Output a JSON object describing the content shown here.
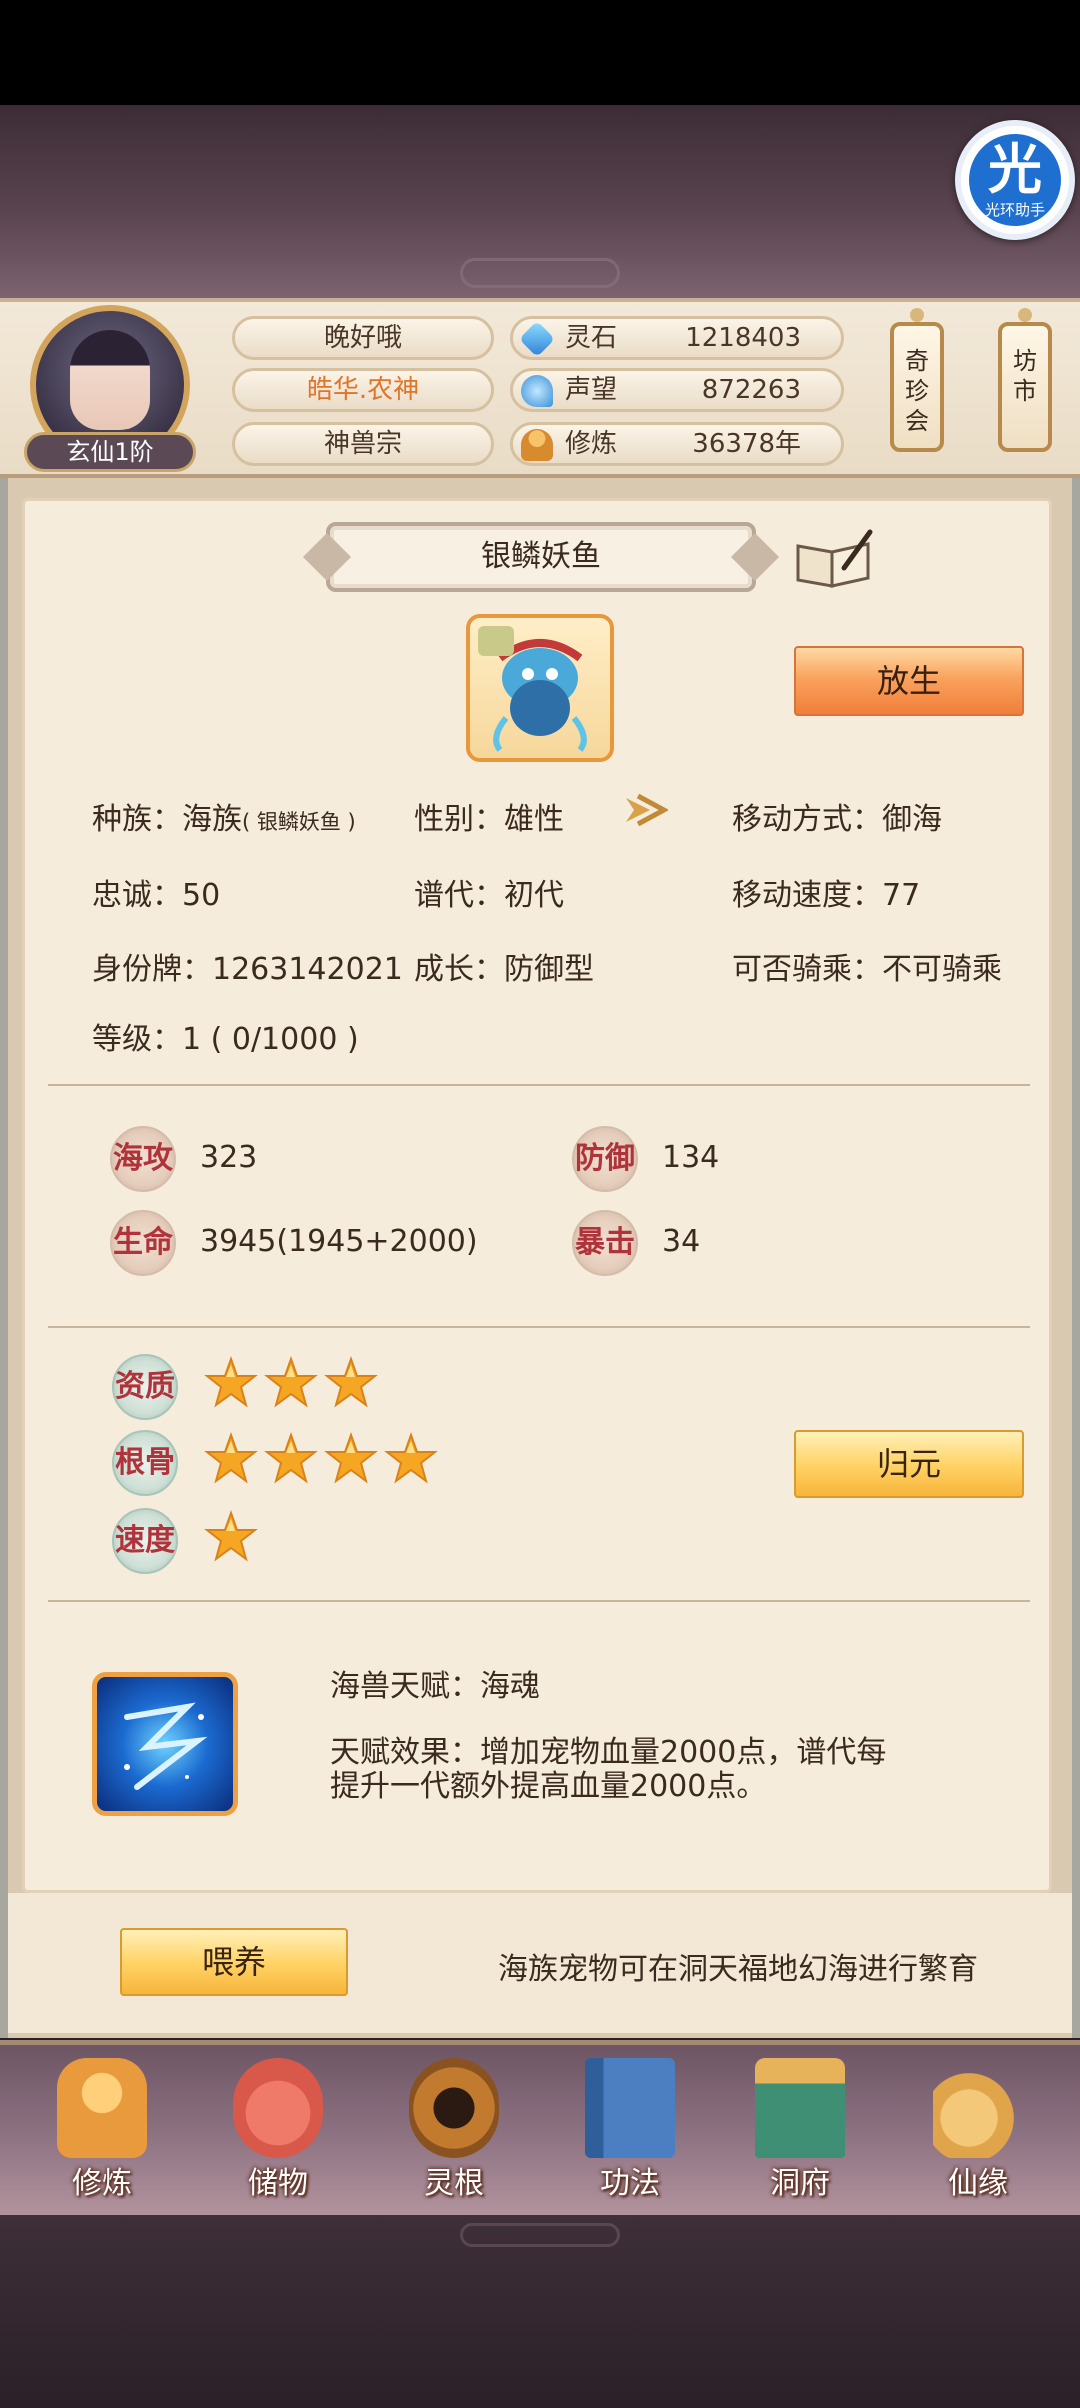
{
  "header": {
    "rank": "玄仙1阶",
    "greeting": "晚好哦",
    "player_name": "皓华.农神",
    "sect": "神兽宗",
    "stats": [
      {
        "label": "灵石",
        "value": "1218403",
        "icon": "spirit-stone-icon"
      },
      {
        "label": "声望",
        "value": "872263",
        "icon": "prestige-icon"
      },
      {
        "label": "修炼",
        "value": "36378年",
        "icon": "cultivation-icon"
      }
    ],
    "side_tags": [
      "奇珍会",
      "坊市"
    ]
  },
  "assistant": {
    "glyph": "光",
    "label": "光环助手"
  },
  "pet": {
    "title": "银鳞妖鱼",
    "release_button": "放生",
    "info": {
      "race_label": "种族：",
      "race_value": "海族",
      "race_note": "( 银鳞妖鱼 )",
      "gender": "性别：雄性",
      "move_mode": "移动方式：御海",
      "loyalty": "忠诚：50",
      "generation": "谱代：初代",
      "move_speed": "移动速度：77",
      "id_card": "身份牌：1263142021",
      "growth": "成长：防御型",
      "rideable": "可否骑乘：不可骑乘",
      "level": "等级：1 ( 0/1000 )"
    },
    "combat": [
      {
        "label": "海攻",
        "value": "323"
      },
      {
        "label": "防御",
        "value": "134"
      },
      {
        "label": "生命",
        "value": "3945(1945+2000)"
      },
      {
        "label": "暴击",
        "value": "34"
      }
    ],
    "aptitude": [
      {
        "label": "资质",
        "stars": 3
      },
      {
        "label": "根骨",
        "stars": 4
      },
      {
        "label": "速度",
        "stars": 1
      }
    ],
    "return_button": "归元",
    "talent": {
      "name": "海兽天赋：海魂",
      "effect_line1": "天赋效果：增加宠物血量2000点，谱代每",
      "effect_line2": "提升一代额外提高血量2000点。"
    }
  },
  "feed": {
    "button": "喂养",
    "hint": "海族宠物可在洞天福地幻海进行繁育"
  },
  "nav": [
    {
      "label": "修炼",
      "icon": "cultivate-icon",
      "color": "#e89a3c"
    },
    {
      "label": "储物",
      "icon": "storage-bag-icon",
      "color": "#d8584a"
    },
    {
      "label": "灵根",
      "icon": "spirit-root-icon",
      "color": "#c27b2e"
    },
    {
      "label": "功法",
      "icon": "technique-book-icon",
      "color": "#4b7fc2"
    },
    {
      "label": "洞府",
      "icon": "cave-abode-icon",
      "color": "#3f8f74"
    },
    {
      "label": "仙缘",
      "icon": "immortal-fate-icon",
      "color": "#e0a44a"
    }
  ],
  "colors": {
    "panel_bg": "#f6ecdb",
    "accent_orange": "#f07f3a",
    "accent_yellow": "#ffd468",
    "stat_red": "#b0333b",
    "star_gold": "#f5a623"
  }
}
